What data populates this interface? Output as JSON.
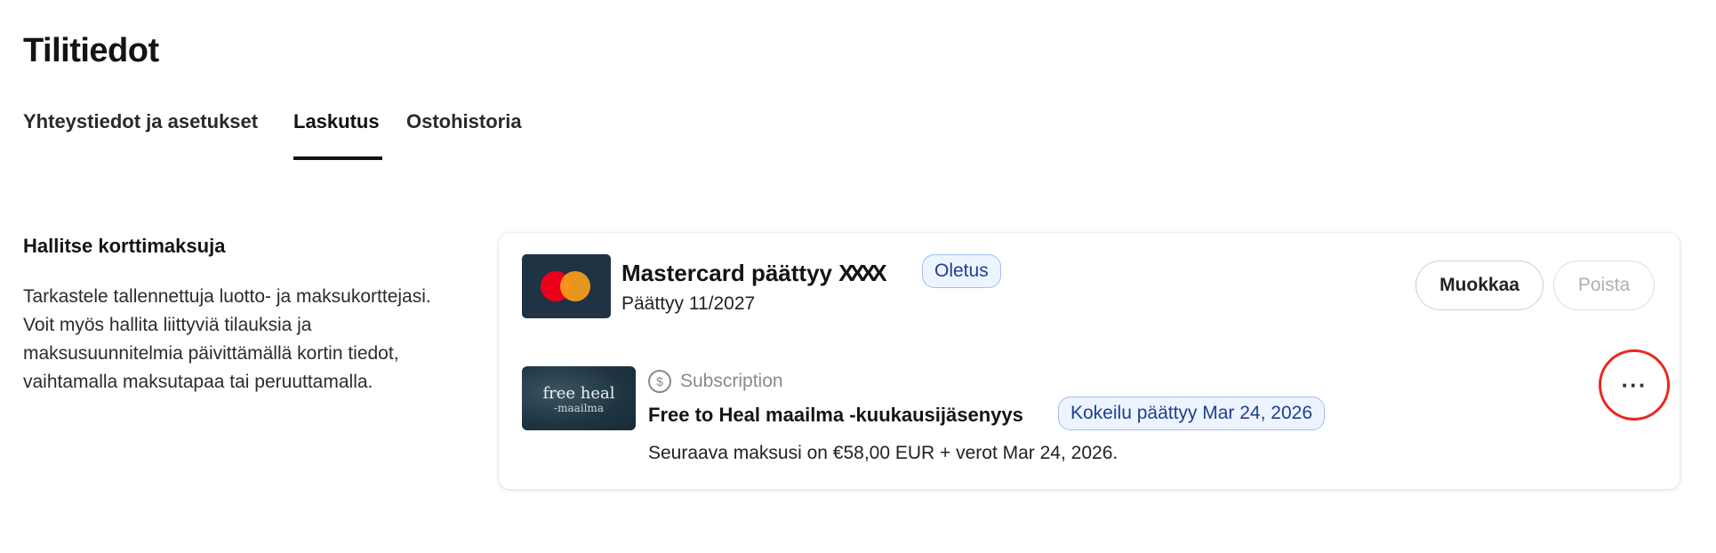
{
  "page": {
    "title": "Tilitiedot"
  },
  "tabs": [
    {
      "label": "Yhteystiedot ja asetukset",
      "active": false
    },
    {
      "label": "Laskutus",
      "active": true
    },
    {
      "label": "Ostohistoria",
      "active": false
    }
  ],
  "section": {
    "heading": "Hallitse korttimaksuja",
    "description": "Tarkastele tallennettuja luotto- ja maksukorttejasi. Voit myös hallita liittyviä tilauksia ja maksusuunnitelmia päivittämällä kortin tiedot, vaihtamalla maksutapaa tai peruuttamalla."
  },
  "card": {
    "brand_icon": "mastercard-logo",
    "name": "Mastercard päättyy",
    "last4_masked": "XXXX",
    "default_badge": "Oletus",
    "expiry": "Päättyy 11/2027",
    "edit_label": "Muokkaa",
    "delete_label": "Poista",
    "delete_disabled": true
  },
  "subscription": {
    "thumb_text_1": "free heal",
    "thumb_text_2": "-maailma",
    "type_icon": "recurring-dollar-icon",
    "type": "Subscription",
    "name": "Free to Heal maailma -kuukausijäsenyys",
    "trial_badge": "Kokeilu päättyy Mar 24, 2026",
    "next_payment": "Seuraava maksusi on €58,00 EUR + verot Mar 24, 2026.",
    "more_label": "···"
  },
  "colors": {
    "accent_highlight": "#e8281e",
    "badge_bg": "#eef4ff",
    "badge_text": "#1d3f8f",
    "card_thumb_bg": "#1f3345"
  }
}
